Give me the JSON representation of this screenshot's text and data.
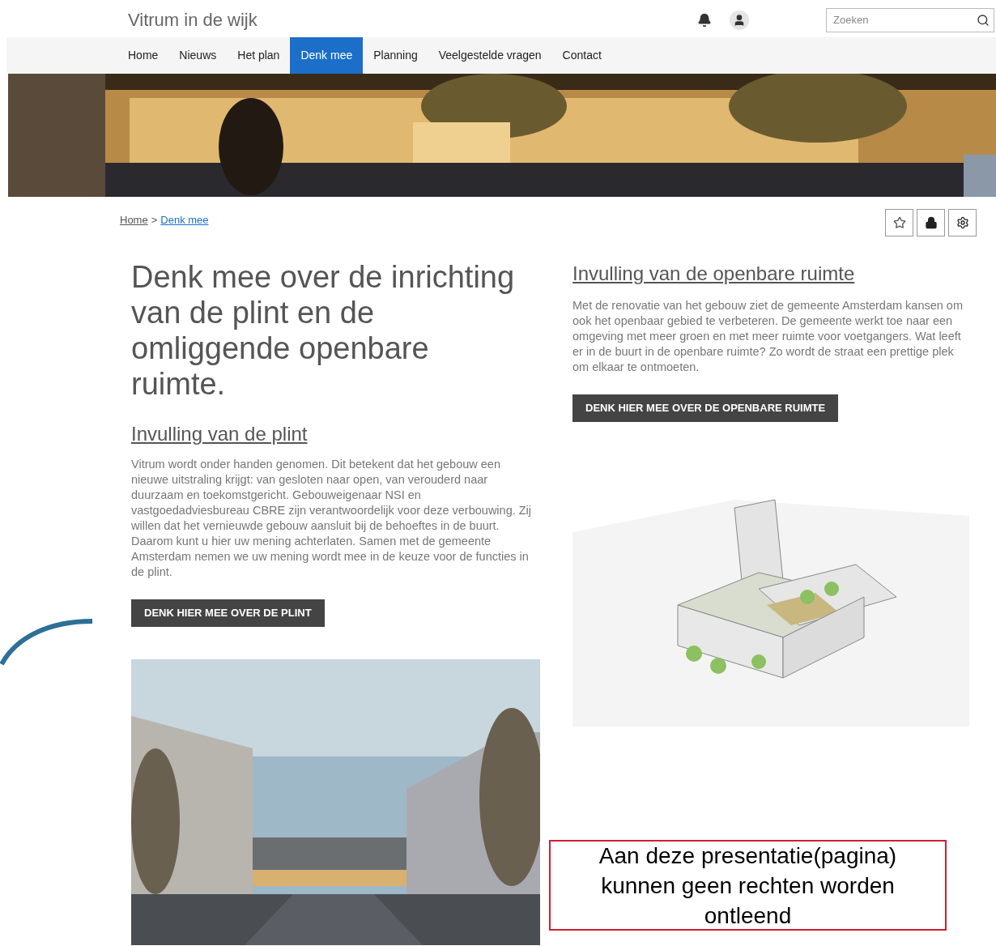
{
  "site_title": "Vitrum in de wijk",
  "search": {
    "placeholder": "Zoeken"
  },
  "nav": [
    {
      "label": "Home",
      "selected": false
    },
    {
      "label": "Nieuws",
      "selected": false
    },
    {
      "label": "Het plan",
      "selected": false
    },
    {
      "label": "Denk mee",
      "selected": true
    },
    {
      "label": "Planning",
      "selected": false
    },
    {
      "label": "Veelgestelde vragen",
      "selected": false
    },
    {
      "label": "Contact",
      "selected": false
    }
  ],
  "breadcrumb": [
    {
      "label": "Home"
    },
    {
      "label": "Denk mee"
    }
  ],
  "breadcrumb_separator": ">",
  "left": {
    "heading": "Denk mee over de inrichting van de plint en de omliggende openbare ruimte.",
    "subheading": "Invulling van de plint",
    "text": "Vitrum wordt onder handen genomen. Dit betekent dat het gebouw een nieuwe uitstraling krijgt: van gesloten naar open, van verouderd naar duurzaam en toekomstgericht. Gebouweigenaar NSI en vastgoedadviesbureau CBRE zijn verantwoordelijk voor deze verbouwing. Zij willen dat het vernieuwde gebouw aansluit bij de behoeftes in de buurt. Daarom kunt u hier uw mening achterlaten. Samen met de gemeente Amsterdam nemen we uw mening wordt mee in de keuze voor de functies in de plint.",
    "button": "DENK HIER MEE OVER DE PLINT"
  },
  "right": {
    "subheading": "Invulling van de openbare ruimte",
    "text": "Met de renovatie van het gebouw ziet de gemeente Amsterdam kansen om ook het openbaar gebied te verbeteren. De gemeente werkt toe naar een omgeving met meer groen en met meer ruimte voor voetgangers. Wat leeft er in de buurt in de openbare ruimte? Zo wordt de straat een prettige plek om elkaar te ontmoeten.",
    "button": "DENK HIER MEE OVER DE OPENBARE RUIMTE"
  },
  "disclaimer": "Aan deze presentatie(pagina) kunnen geen rechten worden ontleend"
}
